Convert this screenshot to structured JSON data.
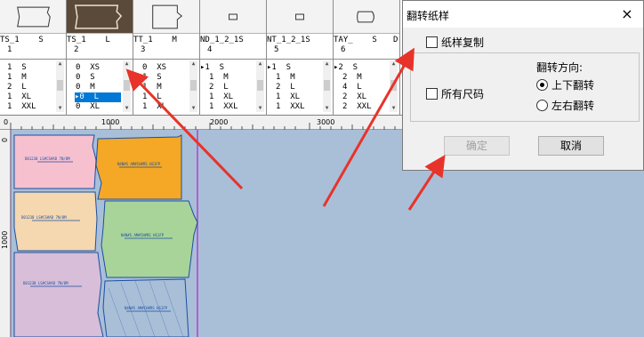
{
  "pieces": [
    {
      "name": "TS_1    S",
      "num": "1",
      "sizes": [
        "1  S",
        "1  M",
        "2  L",
        "1  XL",
        "1  XXL"
      ],
      "selected_row": -1
    },
    {
      "name": "TS_1    L",
      "num": "2",
      "sizes": [
        "0  XS",
        "0  S",
        "0  M",
        "0  L",
        "0  XL"
      ],
      "selected_row": 3
    },
    {
      "name": "TT_1    M",
      "num": "3",
      "sizes": [
        "0  XS",
        "1  S",
        "1  M",
        "1  L",
        "1  XL"
      ],
      "selected_row": -1
    },
    {
      "name": "ND_1_2_1S",
      "num": "4",
      "sizes": [
        "1  S",
        "1  M",
        "2  L",
        "1  XL",
        "1  XXL"
      ],
      "selected_row": -1
    },
    {
      "name": "NT_1_2_1S",
      "num": "5",
      "sizes": [
        "1  S",
        "1  M",
        "2  L",
        "1  XL",
        "1  XXL"
      ],
      "selected_row": -1
    },
    {
      "name": "TAY_    S",
      "num": "6",
      "sizes": [
        "2  S",
        "2  M",
        "4  L",
        "2  XL",
        "2  XXL"
      ],
      "selected_row": -1
    },
    {
      "name": "D",
      "num": "",
      "sizes": [],
      "selected_row": -1
    }
  ],
  "ruler": {
    "h_labels": [
      "0",
      "1000",
      "2000",
      "3000"
    ],
    "v_labels": [
      "0",
      "1000"
    ]
  },
  "canvas": {
    "piece_labels": [
      "D01238 LS#CS#AD 7N/8M",
      "N4N#S AM#CH#RS HS1FP",
      "D01238 LS#CS#AD 7N/8M",
      "N4N#S AM#CH#RS HS1FP",
      "D01238 LS#CS#AD 7N/8M",
      "N4N#S AM#CH#RS HS1FP"
    ],
    "colors": {
      "pink": "#f7c0cf",
      "orange": "#f4a825",
      "peach": "#f5d7b0",
      "green": "#a8d49a",
      "mauve": "#d8bed8",
      "blue": "#a9bfd8",
      "outline": "#1a4fa0"
    }
  },
  "dialog": {
    "title": "翻转纸样",
    "close": "×",
    "copy_label": "纸样复制",
    "all_sizes_label": "所有尺码",
    "direction_label": "翻转方向:",
    "vertical_label": "上下翻转",
    "horizontal_label": "左右翻转",
    "selected_direction": "vertical",
    "ok_label": "确定",
    "cancel_label": "取消"
  },
  "icons": {
    "close": "close-icon",
    "scroll_up": "scroll-up-icon",
    "scroll_down": "scroll-down-icon",
    "pointer": "row-pointer-icon"
  }
}
